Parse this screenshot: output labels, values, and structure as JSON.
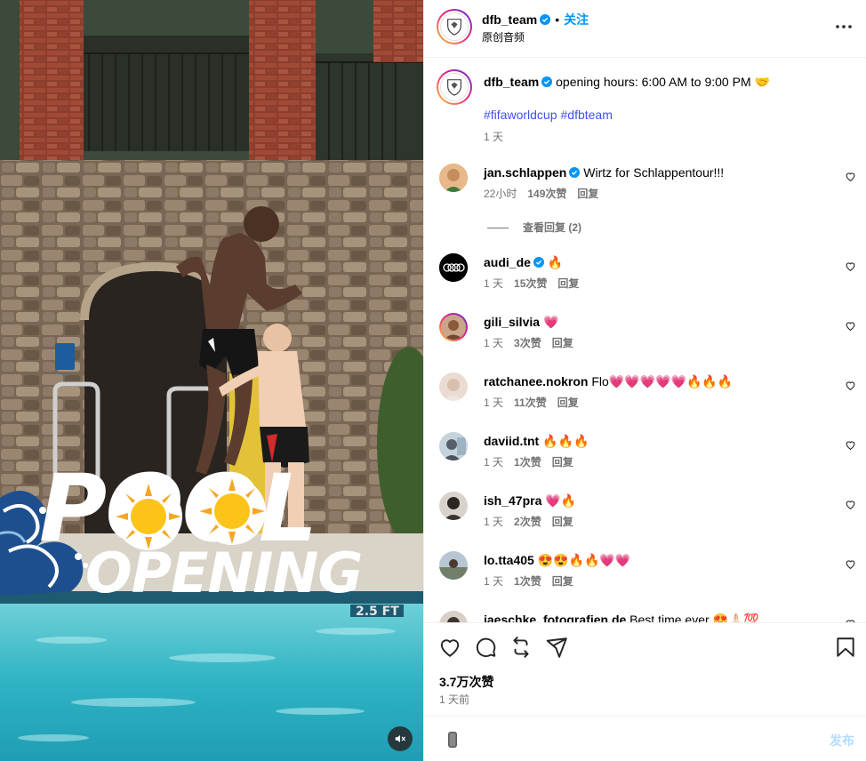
{
  "video": {
    "overlay_line1": "POOL",
    "overlay_line2": "OPENING",
    "sign_text": "2.5 FT",
    "mute_icon": "speaker-muted-icon"
  },
  "header": {
    "username": "dfb_team",
    "separator": "•",
    "follow_label": "关注",
    "audio_label": "原创音频",
    "more_icon": "more-horizontal-icon"
  },
  "caption": {
    "username": "dfb_team",
    "text": "opening hours: 6:00 AM to 9:00 PM",
    "emoji": "🤝",
    "hashtags": [
      "#fifaworldcup",
      "#dfbteam"
    ],
    "time": "1 天"
  },
  "comments": [
    {
      "username": "jan.schlappen",
      "verified": true,
      "text": "Wirtz for Schlappentour!!!",
      "time": "22小时",
      "likes": "149次赞",
      "reply": "回复"
    },
    {
      "username": "audi_de",
      "verified": true,
      "text": "🔥",
      "time": "1 天",
      "likes": "15次赞",
      "reply": "回复"
    },
    {
      "username": "gili_silvia",
      "verified": false,
      "text": "💗",
      "time": "1 天",
      "likes": "3次赞",
      "reply": "回复"
    },
    {
      "username": "ratchanee.nokron",
      "verified": false,
      "text": "Flo💗💗💗💗💗🔥🔥🔥",
      "time": "1 天",
      "likes": "11次赞",
      "reply": "回复"
    },
    {
      "username": "daviid.tnt",
      "verified": false,
      "text": "🔥🔥🔥",
      "time": "1 天",
      "likes": "1次赞",
      "reply": "回复"
    },
    {
      "username": "ish_47pra",
      "verified": false,
      "text": "💗🔥",
      "time": "1 天",
      "likes": "2次赞",
      "reply": "回复"
    },
    {
      "username": "lo.tta405",
      "verified": false,
      "text": "😍😍🔥🔥💗💗",
      "time": "1 天",
      "likes": "1次赞",
      "reply": "回复"
    },
    {
      "username": "jaeschke_fotografien.de",
      "verified": false,
      "text": "Best time ever 😍🙏🏻💯"
    }
  ],
  "view_replies": "查看回复 (2)",
  "actions": {
    "like_icon": "heart-icon",
    "comment_icon": "comment-icon",
    "share_icon": "repost-icon",
    "send_icon": "send-icon",
    "save_icon": "bookmark-icon",
    "likes_count": "3.7万次赞",
    "posted": "1 天前"
  },
  "composer": {
    "placeholder": "",
    "post_label": "发布"
  },
  "colors": {
    "verified": "#0095f6",
    "follow": "#0095f6",
    "hashtag": "#4150f7",
    "post_disabled": "#b3dbff",
    "pool_water": "#2fb3c4"
  }
}
